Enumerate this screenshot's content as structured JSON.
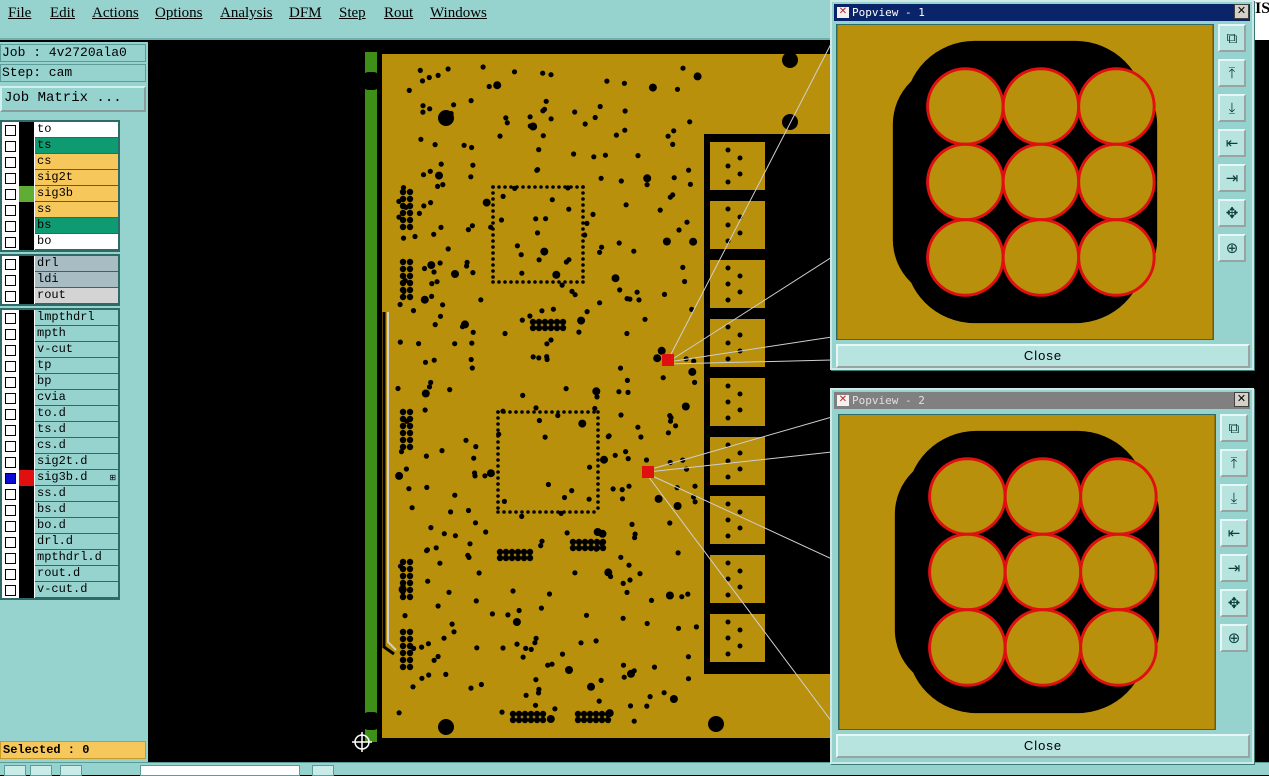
{
  "menu": [
    {
      "label": "File",
      "name": "menu-file"
    },
    {
      "label": "Edit",
      "name": "menu-edit"
    },
    {
      "label": "Actions",
      "name": "menu-actions"
    },
    {
      "label": "Options",
      "name": "menu-options"
    },
    {
      "label": "Analysis",
      "name": "menu-analysis"
    },
    {
      "label": "DFM",
      "name": "menu-dfm"
    },
    {
      "label": "Step",
      "name": "menu-step"
    },
    {
      "label": "Rout",
      "name": "menu-rout"
    },
    {
      "label": "Windows",
      "name": "menu-windows"
    }
  ],
  "job": {
    "job_line": "Job : 4v2720ala0",
    "step_line": "Step: cam"
  },
  "job_matrix_label": "Job Matrix ...",
  "layer_groups": [
    [
      {
        "name": "to",
        "color": "#ffffff"
      },
      {
        "name": "ts",
        "color": "#0f9b72"
      },
      {
        "name": "cs",
        "color": "#f6c85c"
      },
      {
        "name": "sig2t",
        "color": "#f6c85c"
      },
      {
        "name": "sig3b",
        "color": "#f6c85c",
        "swatch": "#5fae33"
      },
      {
        "name": "ss",
        "color": "#f6c85c"
      },
      {
        "name": "bs",
        "color": "#0f9b72"
      },
      {
        "name": "bo",
        "color": "#ffffff"
      }
    ],
    [
      {
        "name": "drl",
        "color": "#a8bcc4"
      },
      {
        "name": "ldi",
        "color": "#a8bcc4"
      },
      {
        "name": "rout",
        "color": "#d4d4d4"
      }
    ],
    [
      {
        "name": "lmpthdrl",
        "color": "#96d3cf"
      },
      {
        "name": "mpth",
        "color": "#96d3cf"
      },
      {
        "name": "v-cut",
        "color": "#96d3cf"
      },
      {
        "name": "tp",
        "color": "#96d3cf"
      },
      {
        "name": "bp",
        "color": "#96d3cf"
      },
      {
        "name": "cvia",
        "color": "#96d3cf"
      },
      {
        "name": "to.d",
        "color": "#96d3cf"
      },
      {
        "name": "ts.d",
        "color": "#96d3cf"
      },
      {
        "name": "cs.d",
        "color": "#96d3cf"
      },
      {
        "name": "sig2t.d",
        "color": "#96d3cf"
      },
      {
        "name": "sig3b.d",
        "color": "#96d3cf",
        "swatch": "#e01010",
        "checked": true,
        "mark": "⊞"
      },
      {
        "name": "ss.d",
        "color": "#96d3cf"
      },
      {
        "name": "bs.d",
        "color": "#96d3cf"
      },
      {
        "name": "bo.d",
        "color": "#96d3cf"
      },
      {
        "name": "drl.d",
        "color": "#96d3cf"
      },
      {
        "name": "mpthdrl.d",
        "color": "#96d3cf"
      },
      {
        "name": "rout.d",
        "color": "#96d3cf"
      },
      {
        "name": "v-cut.d",
        "color": "#96d3cf"
      }
    ]
  ],
  "selected_label": "Selected : 0",
  "popviews": [
    {
      "title": "Popview - 1",
      "close_label": "Close",
      "state": "active"
    },
    {
      "title": "Popview - 2",
      "close_label": "Close",
      "state": "inactive"
    }
  ],
  "corner_text": "IS",
  "colors": {
    "board": "#b8900c",
    "pad_ring": "#e01010",
    "trace_border": "#5fae33",
    "panel": "#96d3cf"
  }
}
